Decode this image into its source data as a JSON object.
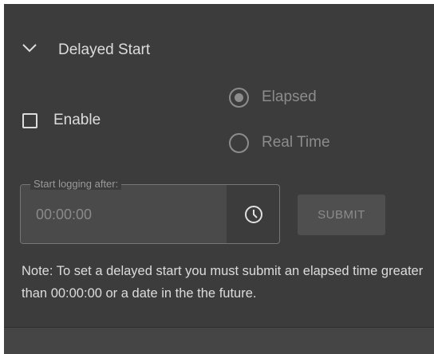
{
  "section": {
    "title": "Delayed Start"
  },
  "enable": {
    "label": "Enable",
    "checked": false
  },
  "mode": {
    "options": [
      {
        "label": "Elapsed",
        "selected": true
      },
      {
        "label": "Real Time",
        "selected": false
      }
    ]
  },
  "start_field": {
    "label": "Start logging after:",
    "value": "00:00:00"
  },
  "submit": {
    "label": "SUBMIT"
  },
  "note": "Note: To set a delayed start you must submit an elapsed time greater than 00:00:00 or a date in the the future.",
  "icons": {
    "collapse": "chevron-down-icon",
    "time": "clock-icon"
  },
  "colors": {
    "panel_background": "#3c3c3c",
    "text": "#dcdcdc",
    "disabled_text": "#8c8c8c"
  }
}
